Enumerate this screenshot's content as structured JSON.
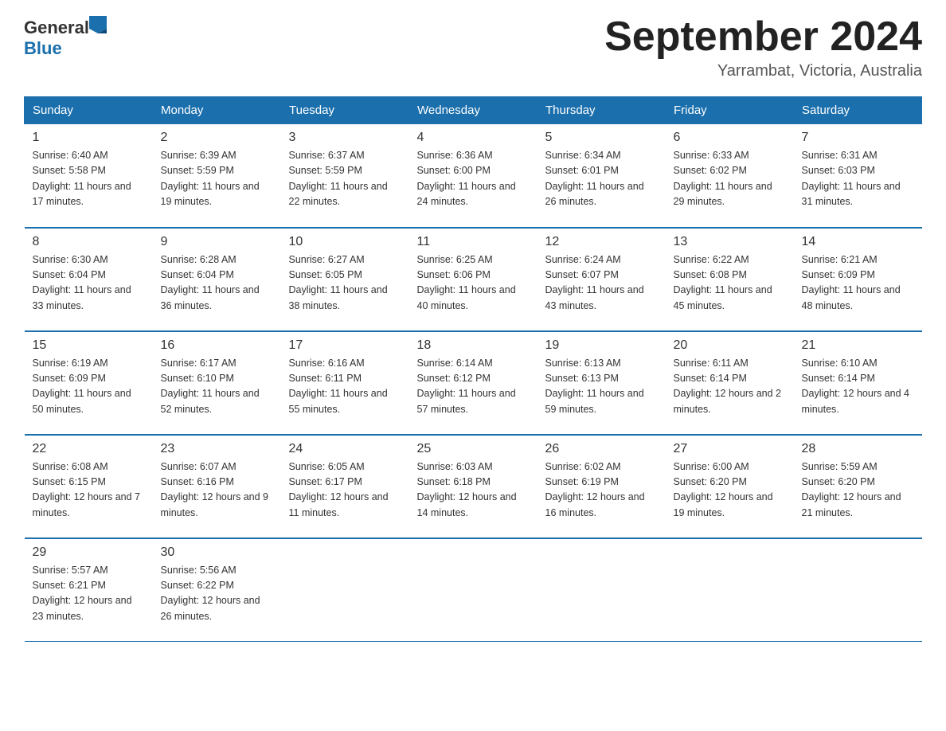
{
  "logo": {
    "general": "General",
    "blue": "Blue"
  },
  "title": "September 2024",
  "location": "Yarrambat, Victoria, Australia",
  "headers": [
    "Sunday",
    "Monday",
    "Tuesday",
    "Wednesday",
    "Thursday",
    "Friday",
    "Saturday"
  ],
  "weeks": [
    [
      {
        "day": "1",
        "sunrise": "6:40 AM",
        "sunset": "5:58 PM",
        "daylight": "11 hours and 17 minutes."
      },
      {
        "day": "2",
        "sunrise": "6:39 AM",
        "sunset": "5:59 PM",
        "daylight": "11 hours and 19 minutes."
      },
      {
        "day": "3",
        "sunrise": "6:37 AM",
        "sunset": "5:59 PM",
        "daylight": "11 hours and 22 minutes."
      },
      {
        "day": "4",
        "sunrise": "6:36 AM",
        "sunset": "6:00 PM",
        "daylight": "11 hours and 24 minutes."
      },
      {
        "day": "5",
        "sunrise": "6:34 AM",
        "sunset": "6:01 PM",
        "daylight": "11 hours and 26 minutes."
      },
      {
        "day": "6",
        "sunrise": "6:33 AM",
        "sunset": "6:02 PM",
        "daylight": "11 hours and 29 minutes."
      },
      {
        "day": "7",
        "sunrise": "6:31 AM",
        "sunset": "6:03 PM",
        "daylight": "11 hours and 31 minutes."
      }
    ],
    [
      {
        "day": "8",
        "sunrise": "6:30 AM",
        "sunset": "6:04 PM",
        "daylight": "11 hours and 33 minutes."
      },
      {
        "day": "9",
        "sunrise": "6:28 AM",
        "sunset": "6:04 PM",
        "daylight": "11 hours and 36 minutes."
      },
      {
        "day": "10",
        "sunrise": "6:27 AM",
        "sunset": "6:05 PM",
        "daylight": "11 hours and 38 minutes."
      },
      {
        "day": "11",
        "sunrise": "6:25 AM",
        "sunset": "6:06 PM",
        "daylight": "11 hours and 40 minutes."
      },
      {
        "day": "12",
        "sunrise": "6:24 AM",
        "sunset": "6:07 PM",
        "daylight": "11 hours and 43 minutes."
      },
      {
        "day": "13",
        "sunrise": "6:22 AM",
        "sunset": "6:08 PM",
        "daylight": "11 hours and 45 minutes."
      },
      {
        "day": "14",
        "sunrise": "6:21 AM",
        "sunset": "6:09 PM",
        "daylight": "11 hours and 48 minutes."
      }
    ],
    [
      {
        "day": "15",
        "sunrise": "6:19 AM",
        "sunset": "6:09 PM",
        "daylight": "11 hours and 50 minutes."
      },
      {
        "day": "16",
        "sunrise": "6:17 AM",
        "sunset": "6:10 PM",
        "daylight": "11 hours and 52 minutes."
      },
      {
        "day": "17",
        "sunrise": "6:16 AM",
        "sunset": "6:11 PM",
        "daylight": "11 hours and 55 minutes."
      },
      {
        "day": "18",
        "sunrise": "6:14 AM",
        "sunset": "6:12 PM",
        "daylight": "11 hours and 57 minutes."
      },
      {
        "day": "19",
        "sunrise": "6:13 AM",
        "sunset": "6:13 PM",
        "daylight": "11 hours and 59 minutes."
      },
      {
        "day": "20",
        "sunrise": "6:11 AM",
        "sunset": "6:14 PM",
        "daylight": "12 hours and 2 minutes."
      },
      {
        "day": "21",
        "sunrise": "6:10 AM",
        "sunset": "6:14 PM",
        "daylight": "12 hours and 4 minutes."
      }
    ],
    [
      {
        "day": "22",
        "sunrise": "6:08 AM",
        "sunset": "6:15 PM",
        "daylight": "12 hours and 7 minutes."
      },
      {
        "day": "23",
        "sunrise": "6:07 AM",
        "sunset": "6:16 PM",
        "daylight": "12 hours and 9 minutes."
      },
      {
        "day": "24",
        "sunrise": "6:05 AM",
        "sunset": "6:17 PM",
        "daylight": "12 hours and 11 minutes."
      },
      {
        "day": "25",
        "sunrise": "6:03 AM",
        "sunset": "6:18 PM",
        "daylight": "12 hours and 14 minutes."
      },
      {
        "day": "26",
        "sunrise": "6:02 AM",
        "sunset": "6:19 PM",
        "daylight": "12 hours and 16 minutes."
      },
      {
        "day": "27",
        "sunrise": "6:00 AM",
        "sunset": "6:20 PM",
        "daylight": "12 hours and 19 minutes."
      },
      {
        "day": "28",
        "sunrise": "5:59 AM",
        "sunset": "6:20 PM",
        "daylight": "12 hours and 21 minutes."
      }
    ],
    [
      {
        "day": "29",
        "sunrise": "5:57 AM",
        "sunset": "6:21 PM",
        "daylight": "12 hours and 23 minutes."
      },
      {
        "day": "30",
        "sunrise": "5:56 AM",
        "sunset": "6:22 PM",
        "daylight": "12 hours and 26 minutes."
      },
      null,
      null,
      null,
      null,
      null
    ]
  ],
  "labels": {
    "sunrise": "Sunrise:",
    "sunset": "Sunset:",
    "daylight": "Daylight:"
  }
}
